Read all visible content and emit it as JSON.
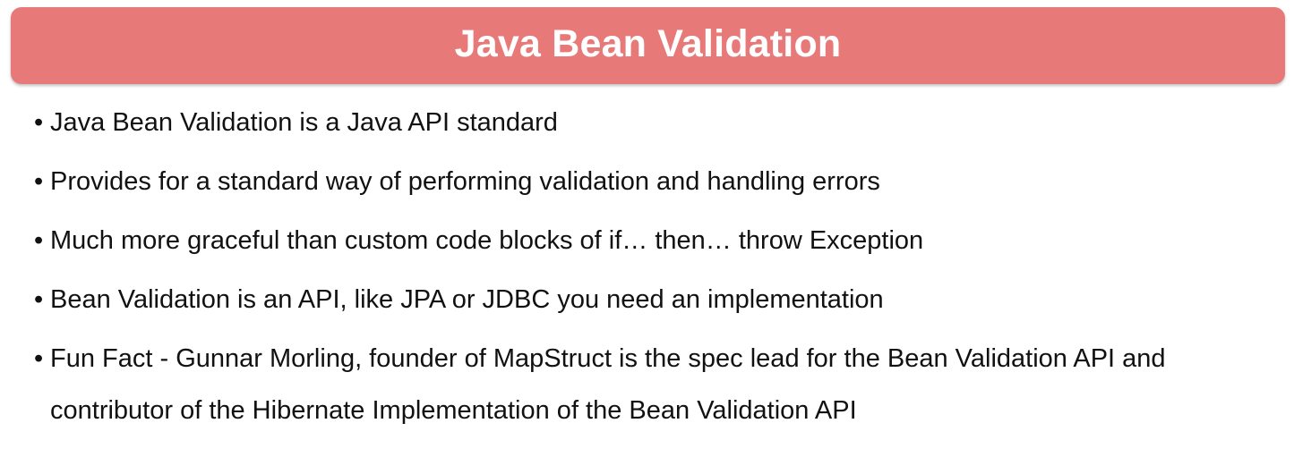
{
  "slide": {
    "title": "Java Bean Validation",
    "bullet_symbol": "•",
    "bullets": [
      "Java Bean Validation is a Java API standard",
      "Provides for a standard way of performing validation and handling errors",
      "Much more graceful than custom code blocks of if… then… throw Exception",
      "Bean Validation is an API, like JPA or JDBC you need an implementation",
      "Fun Fact - Gunnar Morling, founder of MapStruct is the spec lead for the Bean Validation API and contributor of the Hibernate Implementation of the Bean Validation API"
    ]
  },
  "colors": {
    "title_background": "#e87979",
    "title_text": "#ffffff",
    "body_text": "#111111"
  }
}
